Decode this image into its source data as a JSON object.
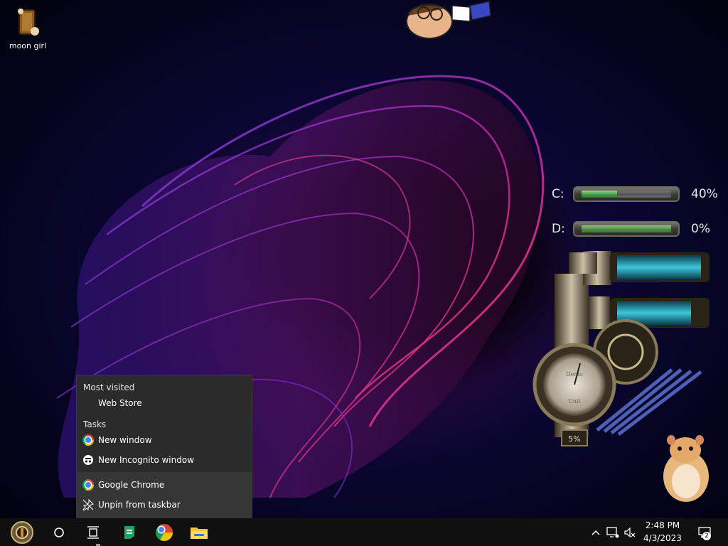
{
  "desktop": {
    "icons": [
      {
        "label": "moon girl",
        "icon": "treasure-chest-icon"
      }
    ]
  },
  "drives": [
    {
      "letter": "C:",
      "percent_text": "40%",
      "usage": 0.4
    },
    {
      "letter": "D:",
      "percent_text": "0%",
      "usage": 0.0
    }
  ],
  "steam_gadget": {
    "dial_percent": "5%",
    "dial_label_top": "Demo",
    "dial_label_bottom": "Unit"
  },
  "jumplist": {
    "most_visited_header": "Most visited",
    "most_visited": [
      {
        "label": "Web Store"
      }
    ],
    "tasks_header": "Tasks",
    "tasks": [
      {
        "label": "New window",
        "icon": "chrome-icon"
      },
      {
        "label": "New Incognito window",
        "icon": "incognito-icon"
      }
    ],
    "app": {
      "label": "Google Chrome",
      "icon": "chrome-icon"
    },
    "unpin": {
      "label": "Unpin from taskbar",
      "icon": "unpin-icon"
    }
  },
  "taskbar": {
    "clock_time": "2:48 PM",
    "clock_date": "4/3/2023",
    "notification_count": "2",
    "apps": [
      "start-icon",
      "search-icon",
      "task-view-icon",
      "sheets-icon",
      "chrome-icon",
      "file-explorer-icon"
    ]
  },
  "colors": {
    "accent_green": "#3f9a3c",
    "jumplist_bg": "#2b2b2b",
    "taskbar_bg": "#101010"
  }
}
